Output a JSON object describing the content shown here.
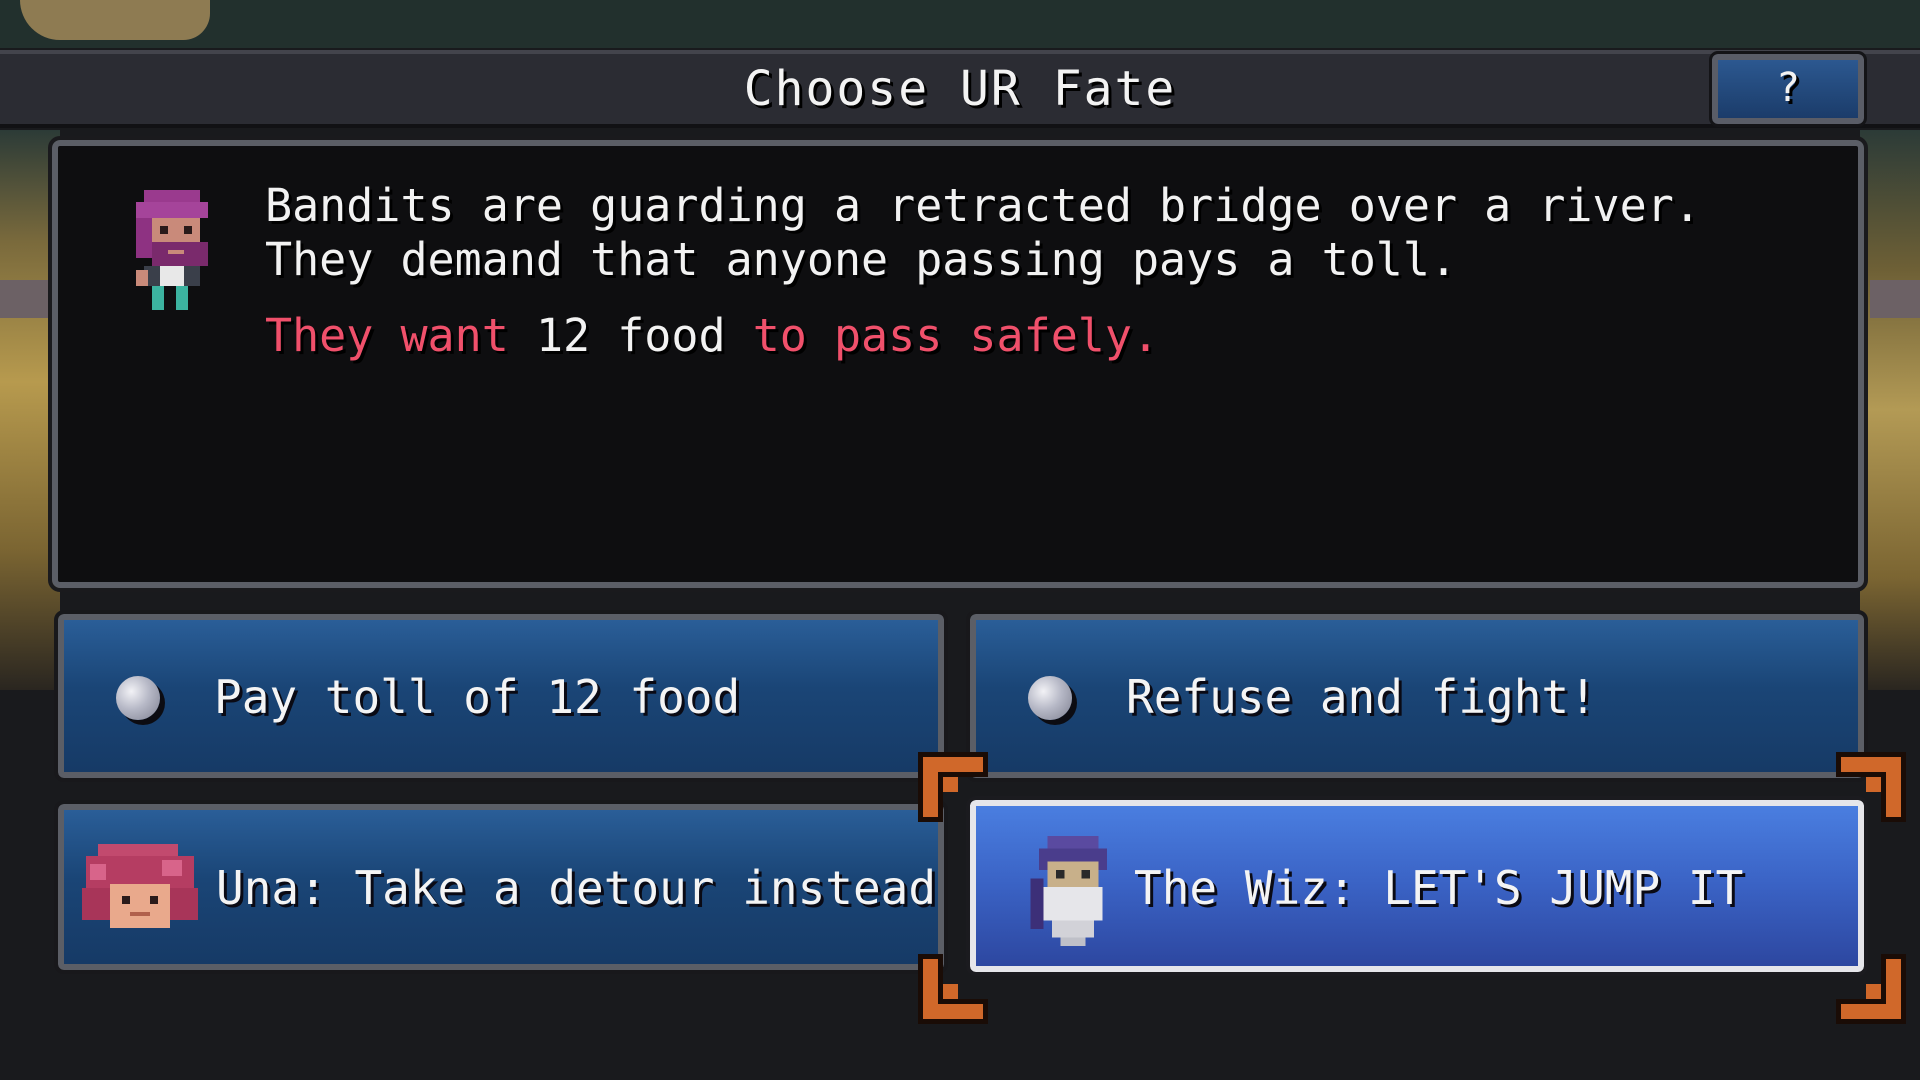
{
  "title_bar": {
    "title": "Choose UR Fate",
    "help_label": "?"
  },
  "dialog": {
    "line1": "Bandits are guarding a retracted bridge over a river.",
    "line2": "They demand that anyone passing pays a toll.",
    "line3_part1": "They want",
    "line3_part2": "12 food",
    "line3_part3": "to pass safely."
  },
  "choices": [
    {
      "label": "Pay toll of 12 food",
      "selected": false
    },
    {
      "label": "Refuse and fight!",
      "selected": false
    },
    {
      "label": "Una: Take a detour instead",
      "selected": false
    },
    {
      "label": "The Wiz: LET'S JUMP IT",
      "selected": true
    }
  ],
  "colors": {
    "highlight_red": "#f0506b",
    "choice_blue": "#1a4576",
    "selected_blue": "#3a62c4",
    "corner_orange": "#d0682a"
  },
  "icons": {
    "speaker": "bandit-portrait-icon",
    "una": "una-portrait-icon",
    "wiz": "wizard-portrait-icon",
    "bullet": "orb-bullet-icon",
    "corner": "selection-corner-icon"
  }
}
